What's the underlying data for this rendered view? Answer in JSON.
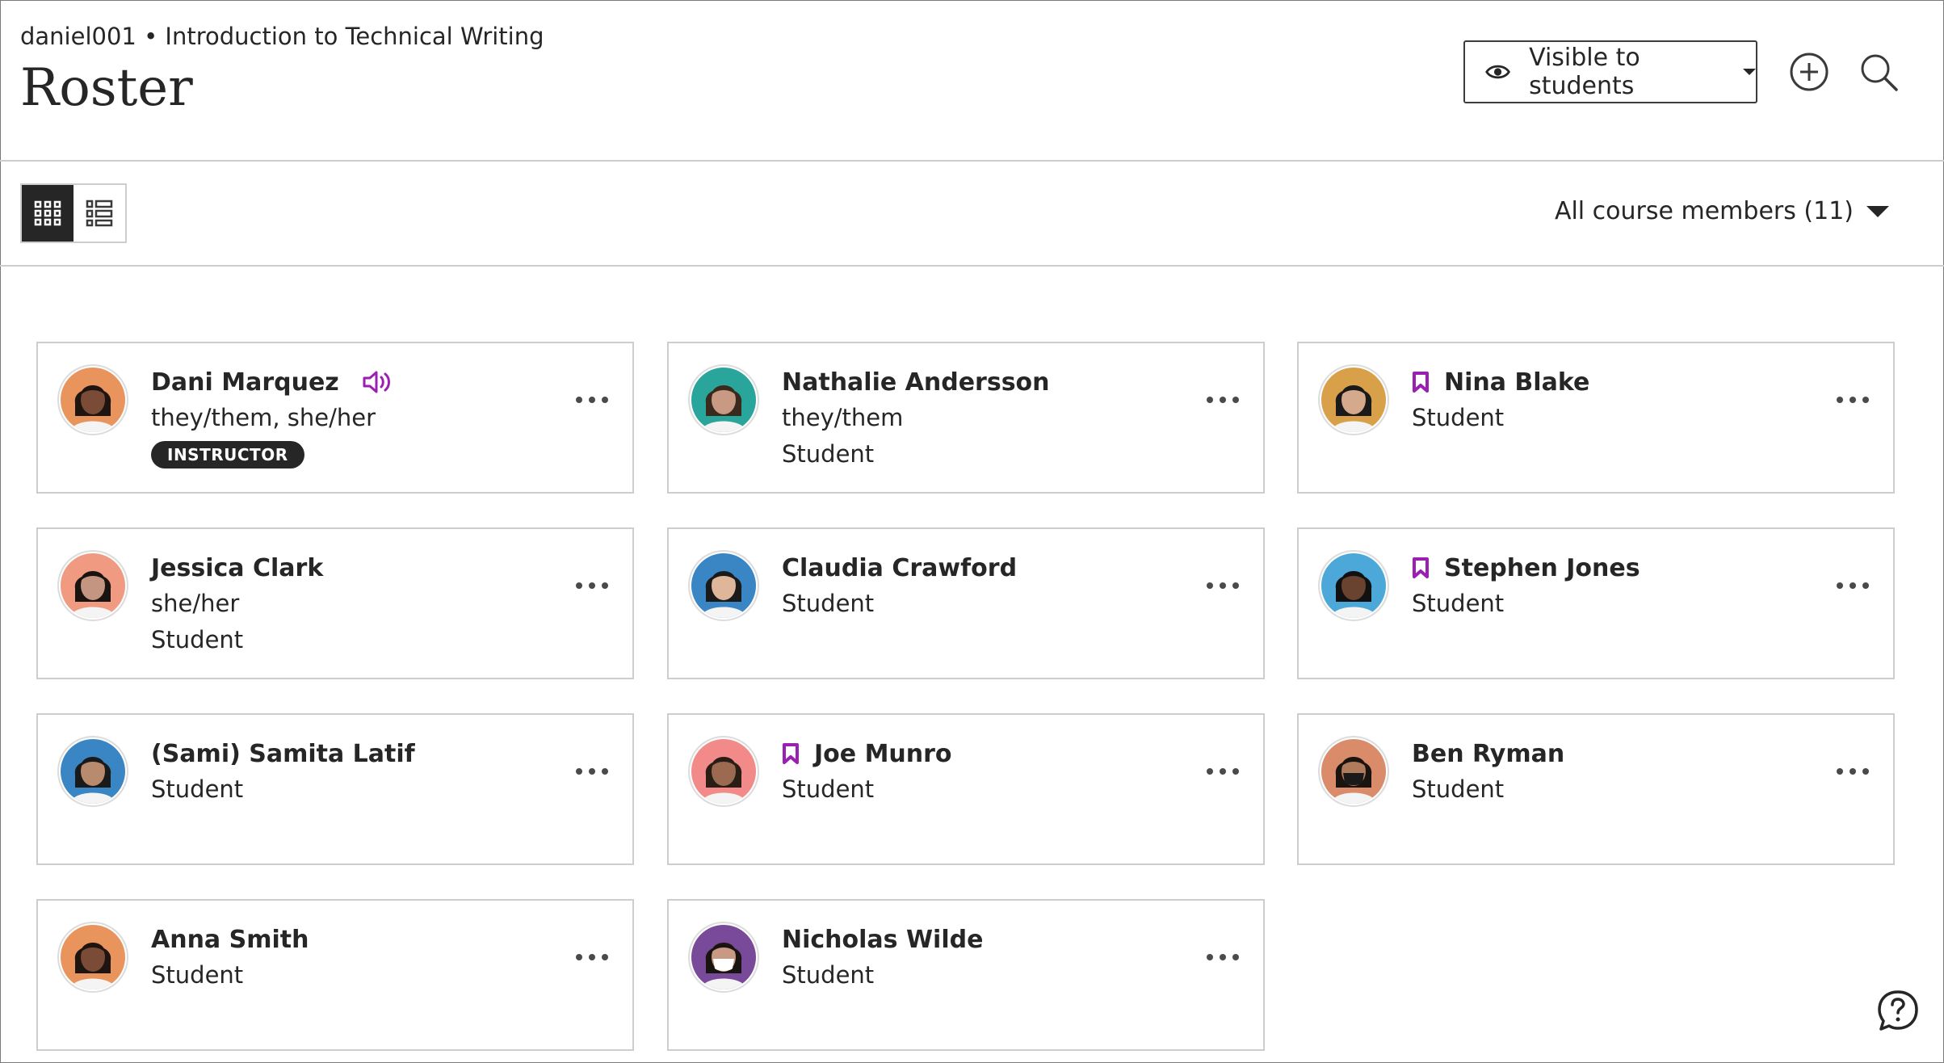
{
  "header": {
    "breadcrumb": "daniel001 • Introduction to Technical Writing",
    "title": "Roster",
    "visibility_label": "Visible to students",
    "add_icon": "plus-circle-icon",
    "search_icon": "search-icon"
  },
  "toolbar": {
    "grid_icon": "grid-view-icon",
    "list_icon": "list-view-icon",
    "filter_label": "All course members (11)"
  },
  "colors": {
    "accent_purple": "#9b1fb3",
    "text": "#262626",
    "border": "#cdcdcd"
  },
  "members": [
    {
      "name": "Dani Marquez",
      "line1": "they/them, she/her",
      "line2": "",
      "badge": "INSTRUCTOR",
      "flag": false,
      "audio": true
    },
    {
      "name": "Nathalie Andersson",
      "line1": "they/them",
      "line2": "Student",
      "badge": "",
      "flag": false,
      "audio": false
    },
    {
      "name": "Nina Blake",
      "line1": "Student",
      "line2": "",
      "badge": "",
      "flag": true,
      "audio": false
    },
    {
      "name": "Jessica Clark",
      "line1": "she/her",
      "line2": "Student",
      "badge": "",
      "flag": false,
      "audio": false
    },
    {
      "name": "Claudia Crawford",
      "line1": "Student",
      "line2": "",
      "badge": "",
      "flag": false,
      "audio": false
    },
    {
      "name": "Stephen Jones",
      "line1": "Student",
      "line2": "",
      "badge": "",
      "flag": true,
      "audio": false
    },
    {
      "name": "(Sami) Samita Latif",
      "line1": "Student",
      "line2": "",
      "badge": "",
      "flag": false,
      "audio": false
    },
    {
      "name": "Joe Munro",
      "line1": "Student",
      "line2": "",
      "badge": "",
      "flag": true,
      "audio": false
    },
    {
      "name": "Ben Ryman",
      "line1": "Student",
      "line2": "",
      "badge": "",
      "flag": false,
      "audio": false
    },
    {
      "name": "Anna Smith",
      "line1": "Student",
      "line2": "",
      "badge": "",
      "flag": false,
      "audio": false
    },
    {
      "name": "Nicholas Wilde",
      "line1": "Student",
      "line2": "",
      "badge": "",
      "flag": false,
      "audio": false
    }
  ],
  "help_icon": "help-chat-icon"
}
